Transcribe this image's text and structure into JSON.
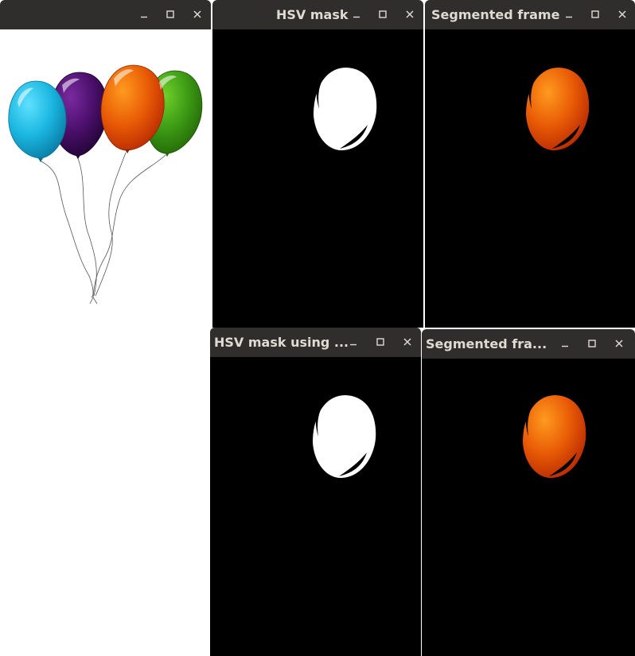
{
  "windows": {
    "original": {
      "title": ""
    },
    "hsv_mask": {
      "title": "HSV mask"
    },
    "segmented": {
      "title": "Segmented frame"
    },
    "hsv_mask_2": {
      "title": "HSV mask using ..."
    },
    "segmented_2": {
      "title": "Segmented fra..."
    }
  },
  "controls": {
    "minimize_icon": "minimize-icon",
    "maximize_icon": "maximize-icon",
    "close_icon": "close-icon"
  },
  "colors": {
    "titlebar": "#2f2e2c",
    "title_text": "#dfdbd2",
    "balloon_blue": "#1ab6e0",
    "balloon_purple": "#4a0f6b",
    "balloon_orange": "#e85a05",
    "balloon_green": "#3c9a14",
    "mask_white": "#ffffff",
    "mask_background": "#000000"
  }
}
